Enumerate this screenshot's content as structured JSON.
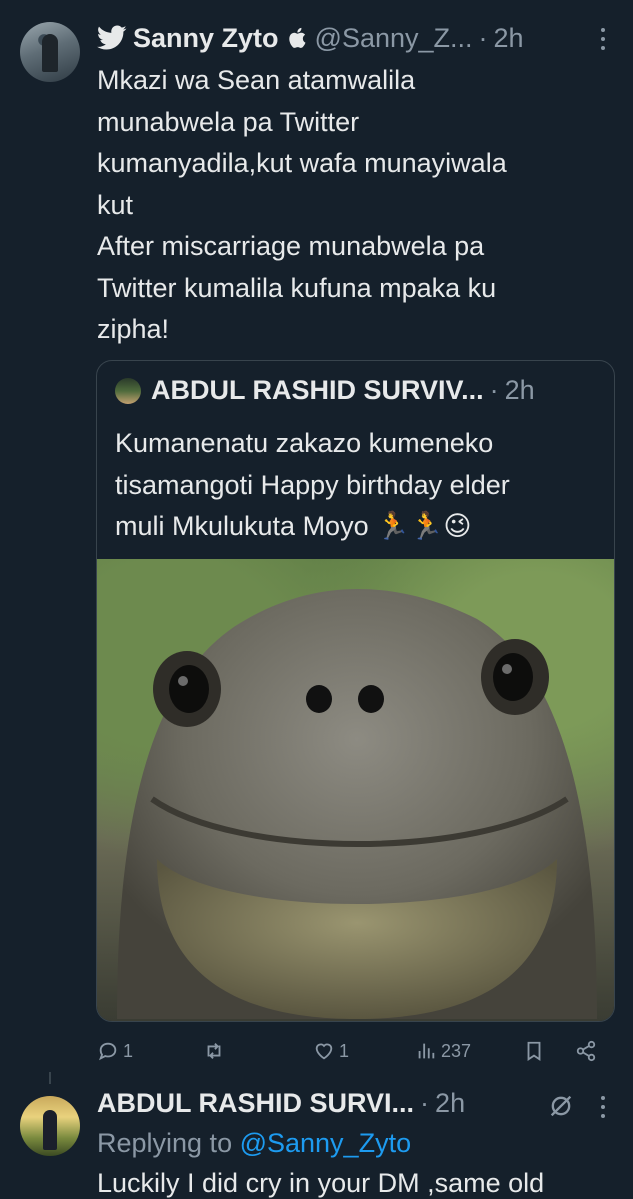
{
  "tweet": {
    "author_name": "Sanny Zyto",
    "handle": "@Sanny_Z...",
    "separator": "·",
    "time": "2h",
    "text": "Mkazi wa Sean atamwalila\nmunabwela pa Twitter\nkumanyadila,kut wafa munayiwala\nkut\nAfter miscarriage munabwela pa\nTwitter kumalila kufuna mpaka ku\nzipha!",
    "icons": [
      "twitter-bird-icon",
      "apple-icon",
      "more-icon"
    ]
  },
  "quoted_tweet": {
    "author_name": "ABDUL RASHID SURVIV...",
    "separator": "·",
    "time": "2h",
    "text": "Kumanenatu zakazo kumeneko\ntisamangoti Happy birthday elder\nmuli Mkulukuta Moyo 🏃🏃😉",
    "image_alt": "tortoise close-up"
  },
  "actions": {
    "reply_count": "1",
    "retweet_count": "",
    "like_count": "1",
    "views_count": "237"
  },
  "reply_tweet": {
    "author_name": "ABDUL RASHID SURVI...",
    "separator": "·",
    "time": "2h",
    "replying_prefix": "Replying to ",
    "replying_handle": "@Sanny_Zyto",
    "text": "Luckily I did cry in your DM ,same old"
  },
  "colors": {
    "background": "#15202b",
    "text": "#e7e9ea",
    "secondary": "#8b98a5",
    "link": "#1d9bf0",
    "border": "#38444d"
  }
}
